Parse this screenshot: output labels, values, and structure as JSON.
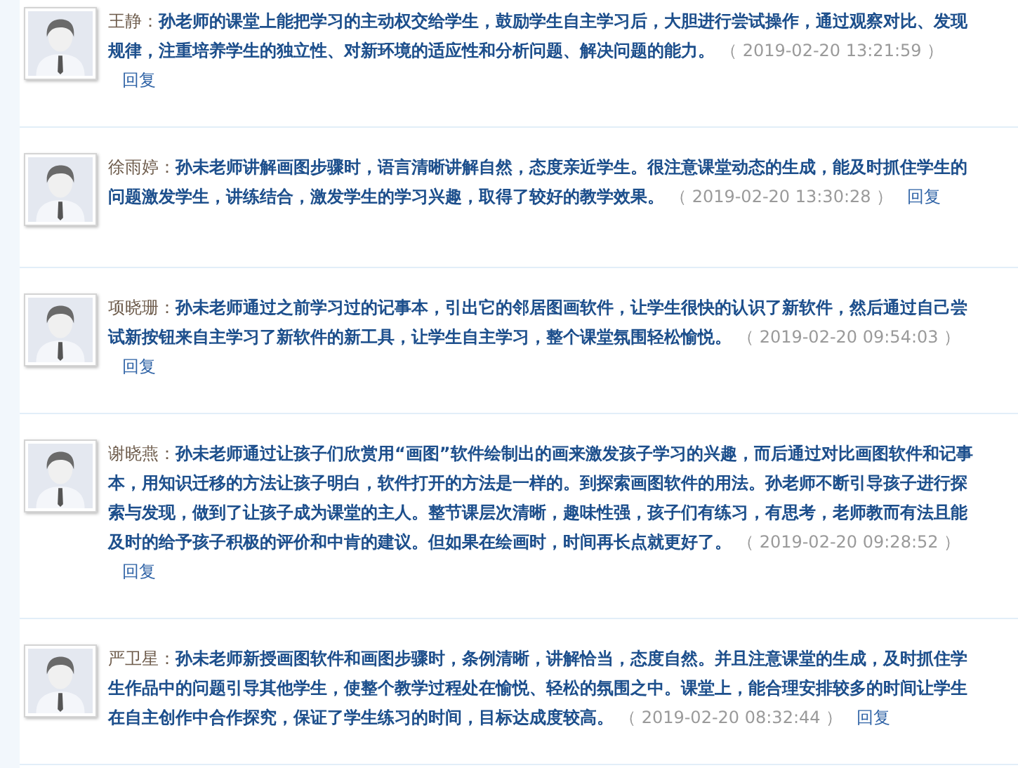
{
  "comments": [
    {
      "author": "王静：",
      "content": "孙老师的课堂上能把学习的主动权交给学生，鼓励学生自主学习后，大胆进行尝试操作，通过观察对比、发现规律，注重培养学生的独立性、对新环境的适应性和分析问题、解决问题的能力。",
      "time": "（ 2019-02-20 13:21:59 ）",
      "reply": "回复"
    },
    {
      "author": "徐雨婷：",
      "content": "孙未老师讲解画图步骤时，语言清晰讲解自然，态度亲近学生。很注意课堂动态的生成，能及时抓住学生的问题激发学生，讲练结合，激发学生的学习兴趣，取得了较好的教学效果。",
      "time": "（ 2019-02-20 13:30:28 ）",
      "reply": "回复"
    },
    {
      "author": "项晓珊：",
      "content": "孙未老师通过之前学习过的记事本，引出它的邻居图画软件，让学生很快的认识了新软件，然后通过自己尝试新按钮来自主学习了新软件的新工具，让学生自主学习，整个课堂氛围轻松愉悦。",
      "time": "（ 2019-02-20 09:54:03 ）",
      "reply": "回复"
    },
    {
      "author": "谢晓燕：",
      "content": "孙未老师通过让孩子们欣赏用“画图”软件绘制出的画来激发孩子学习的兴趣，而后通过对比画图软件和记事本，用知识迁移的方法让孩子明白，软件打开的方法是一样的。到探索画图软件的用法。孙老师不断引导孩子进行探索与发现，做到了让孩子成为课堂的主人。整节课层次清晰，趣味性强，孩子们有练习，有思考，老师教而有法且能及时的给予孩子积极的评价和中肯的建议。但如果在绘画时，时间再长点就更好了。",
      "time": "（ 2019-02-20 09:28:52 ）",
      "reply": "回复"
    },
    {
      "author": "严卫星：",
      "content": "孙未老师新授画图软件和画图步骤时，条例清晰，讲解恰当，态度自然。并且注意课堂的生成，及时抓住学生作品中的问题引导其他学生，使整个教学过程处在愉悦、轻松的氛围之中。课堂上，能合理安排较多的时间让学生在自主创作中合作探究，保证了学生练习的时间，目标达成度较高。",
      "time": "（ 2019-02-20 08:32:44 ）",
      "reply": "回复"
    }
  ]
}
